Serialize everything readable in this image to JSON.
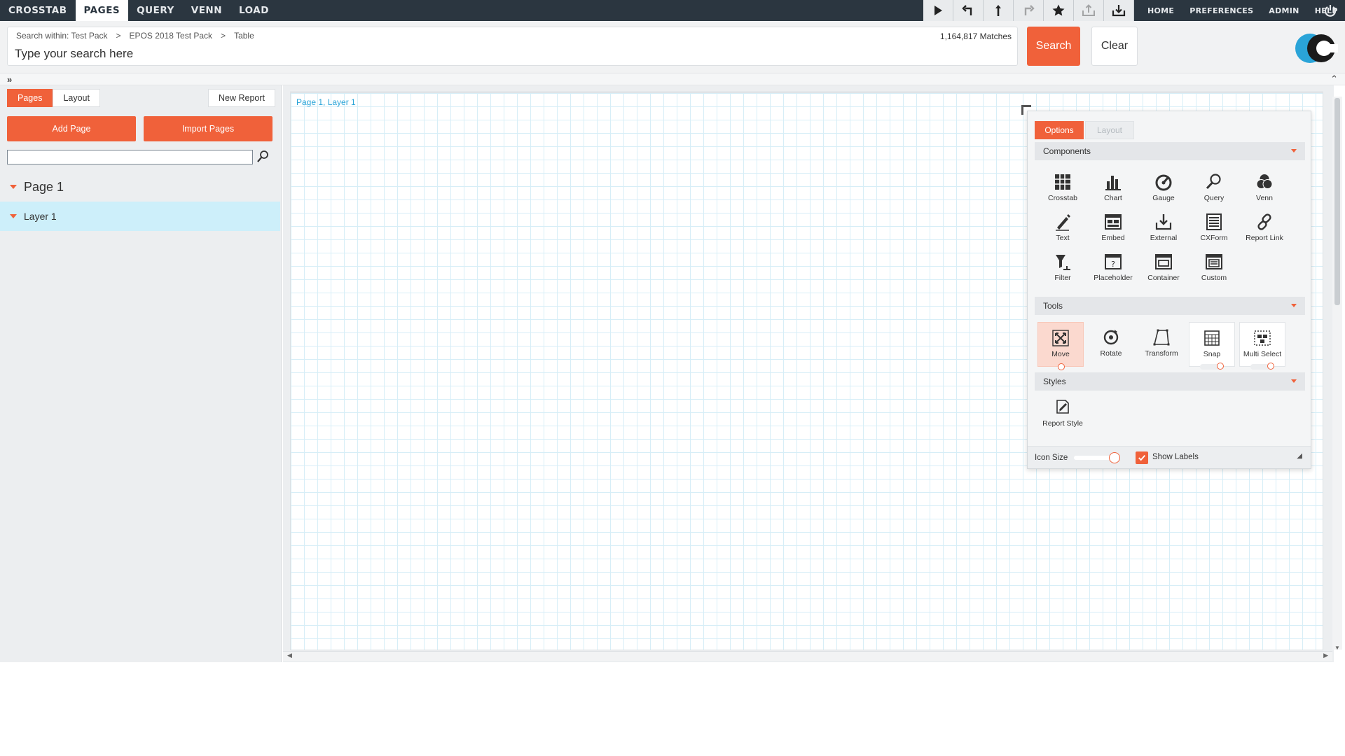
{
  "topnav": {
    "tabs": [
      {
        "label": "CROSSTAB",
        "active": false
      },
      {
        "label": "PAGES",
        "active": true
      },
      {
        "label": "QUERY",
        "active": false
      },
      {
        "label": "VENN",
        "active": false
      },
      {
        "label": "LOAD",
        "active": false
      }
    ],
    "tool_icons": [
      "play-icon",
      "undo-icon",
      "upload-icon",
      "redo-icon",
      "star-icon",
      "export-icon",
      "download-icon"
    ],
    "right_links": [
      "HOME",
      "PREFERENCES",
      "ADMIN",
      "HELP"
    ]
  },
  "search": {
    "breadcrumbs": [
      "Search within: Test Pack",
      "EPOS 2018 Test Pack",
      "Table"
    ],
    "breadcrumb_separator": ">",
    "placeholder": "Type your search here",
    "matches": "1,164,817 Matches",
    "search_label": "Search",
    "clear_label": "Clear"
  },
  "left_panel": {
    "tabs": [
      "Pages",
      "Layout"
    ],
    "active_tab": "Pages",
    "new_report_label": "New Report",
    "add_page_label": "Add Page",
    "import_pages_label": "Import Pages",
    "filter_value": "",
    "tree": {
      "page_label": "Page 1",
      "layer_label": "Layer 1"
    }
  },
  "canvas": {
    "label": "Page 1, Layer 1"
  },
  "panel": {
    "tabs": [
      "Options",
      "Layout"
    ],
    "active_tab": "Options",
    "components_title": "Components",
    "components": [
      {
        "label": "Crosstab",
        "icon": "crosstab-icon"
      },
      {
        "label": "Chart",
        "icon": "chart-icon"
      },
      {
        "label": "Gauge",
        "icon": "gauge-icon"
      },
      {
        "label": "Query",
        "icon": "query-icon"
      },
      {
        "label": "Venn",
        "icon": "venn-icon"
      },
      {
        "label": "Text",
        "icon": "text-icon"
      },
      {
        "label": "Embed",
        "icon": "embed-icon"
      },
      {
        "label": "External",
        "icon": "external-icon"
      },
      {
        "label": "CXForm",
        "icon": "cxform-icon"
      },
      {
        "label": "Report Link",
        "icon": "report-link-icon"
      },
      {
        "label": "Filter",
        "icon": "filter-icon"
      },
      {
        "label": "Placeholder",
        "icon": "placeholder-icon"
      },
      {
        "label": "Container",
        "icon": "container-icon"
      },
      {
        "label": "Custom",
        "icon": "custom-icon"
      }
    ],
    "tools_title": "Tools",
    "tools": [
      {
        "label": "Move",
        "icon": "move-icon",
        "selected": true
      },
      {
        "label": "Rotate",
        "icon": "rotate-icon",
        "selected": false
      },
      {
        "label": "Transform",
        "icon": "transform-icon",
        "selected": false
      },
      {
        "label": "Snap",
        "icon": "snap-icon",
        "selected": false
      },
      {
        "label": "Multi Select",
        "icon": "multi-select-icon",
        "selected": false
      }
    ],
    "styles_title": "Styles",
    "styles": [
      {
        "label": "Report Style",
        "icon": "report-style-icon"
      }
    ],
    "footer": {
      "icon_size_label": "Icon Size",
      "show_labels_label": "Show Labels",
      "show_labels_checked": true
    }
  },
  "colors": {
    "accent": "#f0613a",
    "topbar": "#2b3640",
    "selection": "#cdeffa",
    "canvas_link": "#2aa4d8"
  }
}
